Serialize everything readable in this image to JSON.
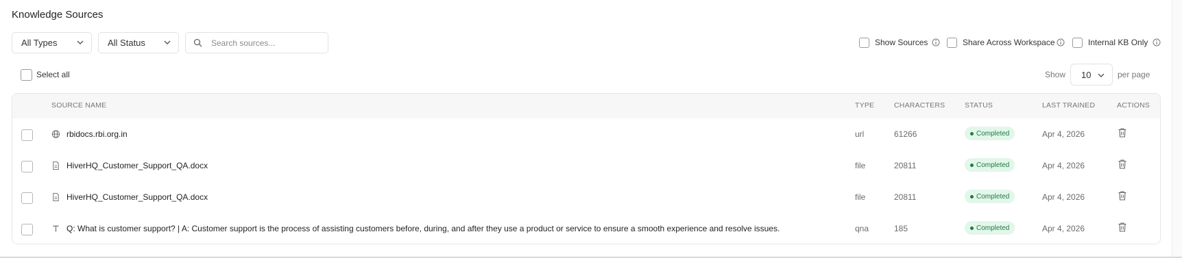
{
  "page": {
    "title": "Knowledge Sources"
  },
  "filters": {
    "type": {
      "selected": "All Types"
    },
    "status": {
      "selected": "All Status"
    },
    "search": {
      "placeholder": "Search sources...",
      "value": ""
    }
  },
  "options": [
    {
      "label": "Show Sources",
      "checked": false
    },
    {
      "label": "Share Across Workspace",
      "checked": false
    },
    {
      "label": "Internal KB Only",
      "checked": false
    }
  ],
  "select_all": {
    "label": "Select all",
    "checked": false
  },
  "pagination": {
    "show_label": "Show",
    "per_page_value": "10",
    "per_page_label": "per page"
  },
  "table": {
    "columns": [
      "SOURCE NAME",
      "TYPE",
      "CHARACTERS",
      "STATUS",
      "LAST TRAINED",
      "ACTIONS"
    ],
    "rows": [
      {
        "icon": "globe-icon",
        "name": "rbidocs.rbi.org.in",
        "type": "url",
        "characters": "61266",
        "status": "Completed",
        "last_trained": "Apr 4, 2026"
      },
      {
        "icon": "document-icon",
        "name": "HiverHQ_Customer_Support_QA.docx",
        "type": "file",
        "characters": "20811",
        "status": "Completed",
        "last_trained": "Apr 4, 2026"
      },
      {
        "icon": "document-icon",
        "name": "HiverHQ_Customer_Support_QA.docx",
        "type": "file",
        "characters": "20811",
        "status": "Completed",
        "last_trained": "Apr 4, 2026"
      },
      {
        "icon": "text-icon",
        "name": "Q: What is customer support? | A: Customer support is the process of assisting customers before, during, and after they use a product or service to ensure a smooth experience and resolve issues.",
        "type": "qna",
        "characters": "185",
        "status": "Completed",
        "last_trained": "Apr 4, 2026"
      }
    ]
  },
  "colors": {
    "status_completed_bg": "#e3f6ea",
    "status_completed_text": "#1f7a44"
  }
}
